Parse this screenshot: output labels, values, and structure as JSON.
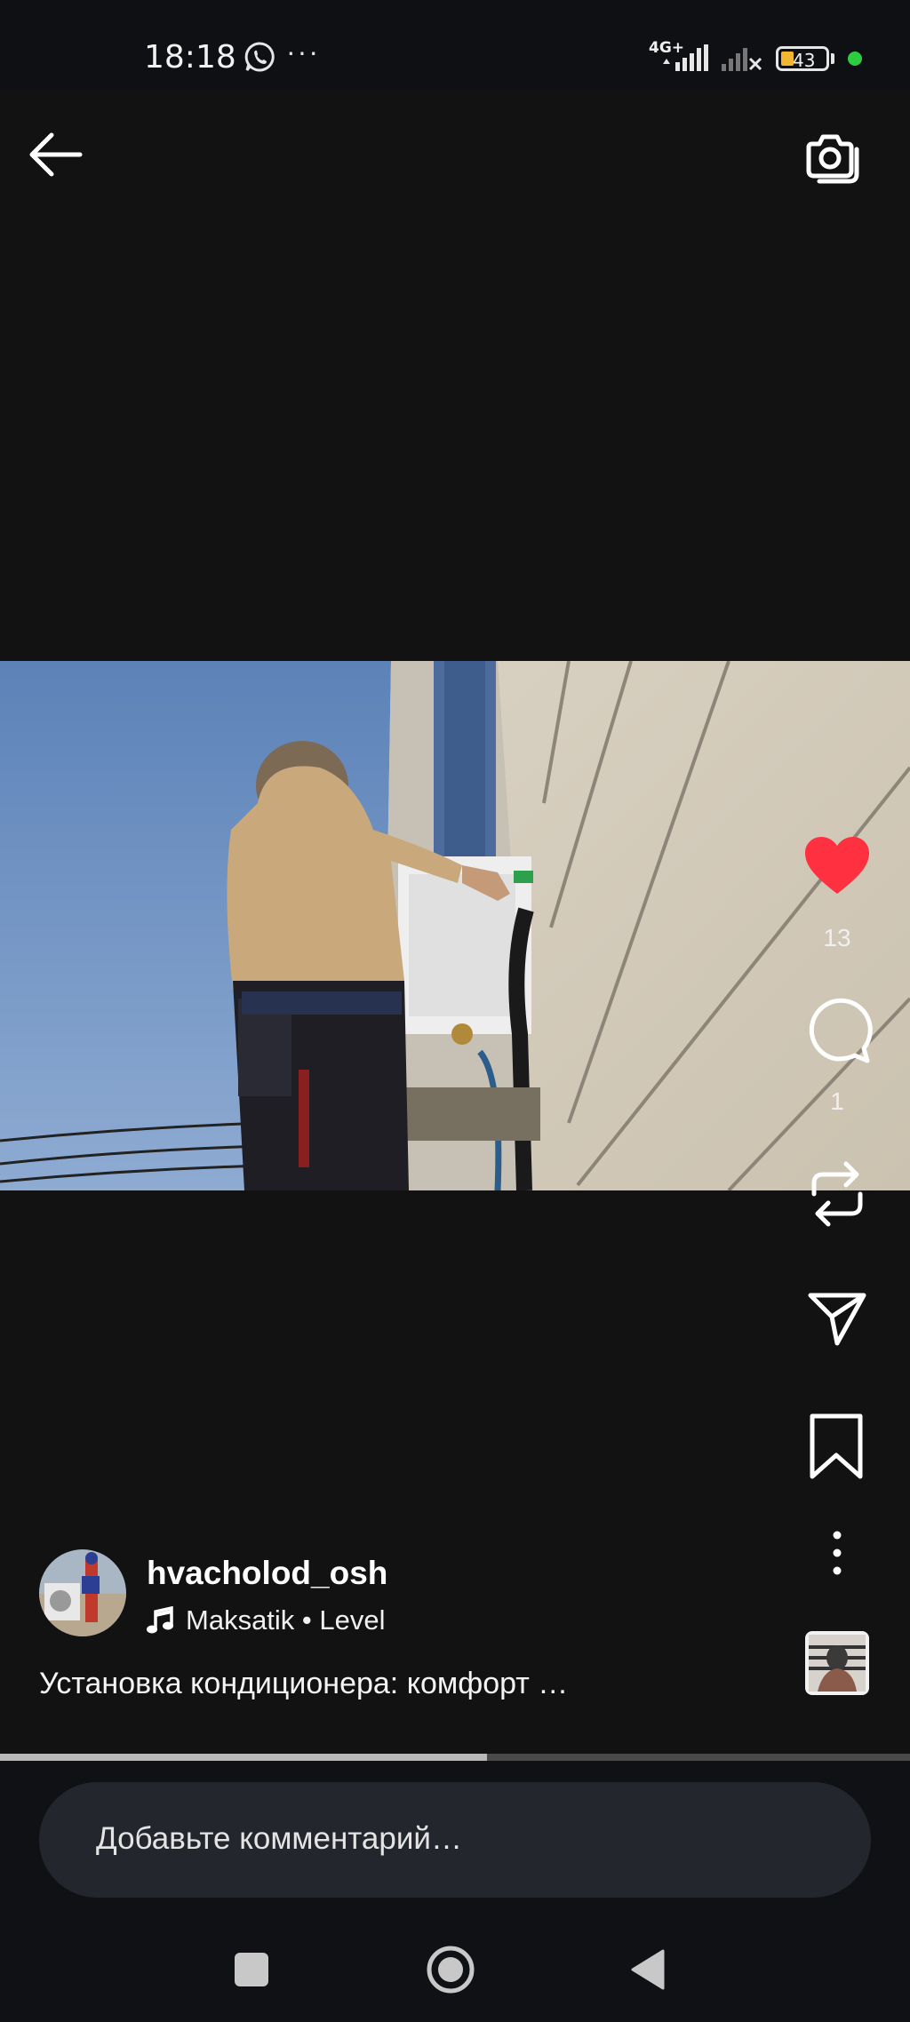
{
  "status_bar": {
    "time": "18:18",
    "network_type": "4G+",
    "battery_level": "43",
    "notification_icons": [
      "whatsapp-icon",
      "more-dots-icon"
    ],
    "indicator_color": "#2ecc40"
  },
  "top_nav": {
    "back_icon": "arrow-left-icon",
    "camera_icon": "camera-icon"
  },
  "reel": {
    "like_count": "13",
    "comment_count": "1",
    "liked": true,
    "like_color": "#ff3040",
    "author": {
      "username": "hvacholod_osh"
    },
    "audio": {
      "track": "Maksatik • Level"
    },
    "caption": "Установка кондиционера: комфорт …",
    "progress": 0.535
  },
  "comment_bar": {
    "placeholder": "Добавьте комментарий…"
  },
  "nav_bar": {
    "icons": [
      "recents-square-icon",
      "home-circle-icon",
      "back-triangle-icon"
    ]
  }
}
